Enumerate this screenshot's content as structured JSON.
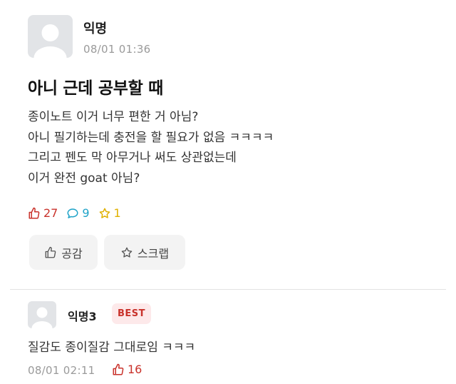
{
  "post": {
    "author": "익명",
    "date": "08/01 01:36",
    "title": "아니 근데 공부할 때",
    "body_lines": [
      "종이노트 이거 너무 편한 거 아님?",
      "아니 필기하는데 충전을 할 필요가 없음 ㅋㅋㅋㅋ",
      "그리고 펜도 막 아무거나 써도 상관없는데",
      "이거 완전 goat 아님?"
    ],
    "stats": {
      "likes": "27",
      "comments": "9",
      "scraps": "1"
    },
    "actions": {
      "like_label": "공감",
      "scrap_label": "스크랩"
    }
  },
  "comment": {
    "author": "익명3",
    "badge": "BEST",
    "body": "질감도 종이질감 그대로임 ㅋㅋㅋ",
    "date": "08/01 02:11",
    "likes": "16"
  },
  "colors": {
    "like": "#c9322b",
    "comment": "#1fa3c8",
    "scrap": "#e0b100",
    "best_bg": "#fde9ea"
  },
  "icons": [
    "avatar-placeholder-icon",
    "thumbs-up-icon",
    "speech-bubble-icon",
    "star-icon"
  ]
}
